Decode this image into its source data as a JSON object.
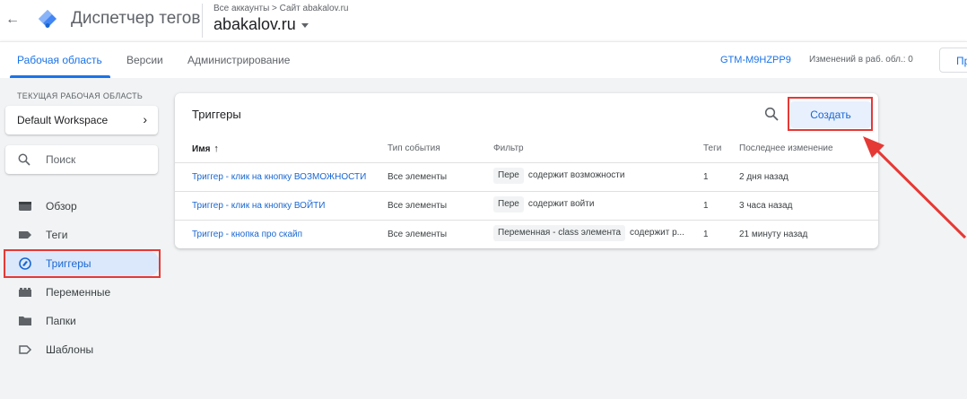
{
  "header": {
    "app_title": "Диспетчер тегов",
    "breadcrumb": "Все аккаунты > Сайт abakalov.ru",
    "account_name": "abakalov.ru"
  },
  "tabs": [
    {
      "label": "Рабочая область"
    },
    {
      "label": "Версии"
    },
    {
      "label": "Администрирование"
    }
  ],
  "toolbar": {
    "container_id": "GTM-M9HZPP9",
    "changes_label": "Изменений в раб. обл.: 0",
    "preview_label": "Пр"
  },
  "sidebar": {
    "workspace_label": "ТЕКУЩАЯ РАБОЧАЯ ОБЛАСТЬ",
    "workspace_name": "Default Workspace",
    "search_label": "Поиск",
    "items": [
      {
        "label": "Обзор",
        "icon": "overview-icon"
      },
      {
        "label": "Теги",
        "icon": "tag-icon"
      },
      {
        "label": "Триггеры",
        "icon": "trigger-icon"
      },
      {
        "label": "Переменные",
        "icon": "variables-icon"
      },
      {
        "label": "Папки",
        "icon": "folder-icon"
      },
      {
        "label": "Шаблоны",
        "icon": "templates-icon"
      }
    ]
  },
  "triggers": {
    "title": "Триггеры",
    "create_label": "Создать",
    "columns": {
      "name": "Имя",
      "event_type": "Тип события",
      "filter": "Фильтр",
      "tags": "Теги",
      "last_modified": "Последнее изменение"
    },
    "rows": [
      {
        "name": "Триггер - клик на кнопку ВОЗМОЖНОСТИ",
        "event_type": "Все элементы",
        "filter_var": "Пере",
        "filter_cond": "содержит возможности",
        "tags": "1",
        "last_modified": "2 дня назад"
      },
      {
        "name": "Триггер - клик на кнопку ВОЙТИ",
        "event_type": "Все элементы",
        "filter_var": "Пере",
        "filter_cond": "содержит войти",
        "tags": "1",
        "last_modified": "3 часа назад"
      },
      {
        "name": "Триггер - кнопка про скайп",
        "event_type": "Все элементы",
        "filter_var": "Переменная - class элемента",
        "filter_cond": "содержит р...",
        "tags": "1",
        "last_modified": "21 минуту назад"
      }
    ]
  },
  "colors": {
    "accent": "#1a73e8",
    "highlight": "#e53935",
    "active_nav_bg": "#dbe8fb"
  }
}
